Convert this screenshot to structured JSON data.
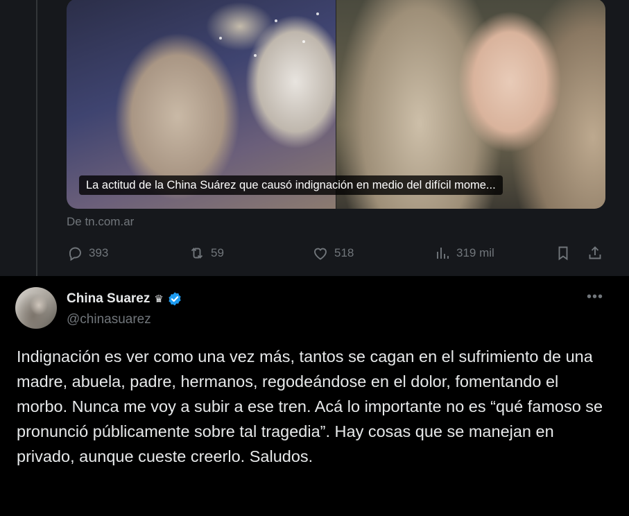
{
  "link_card": {
    "caption": "La actitud de la China Suárez que causó indignación en medio del difícil mome...",
    "source": "De tn.com.ar"
  },
  "parent_actions": {
    "replies": "393",
    "retweets": "59",
    "likes": "518",
    "views": "319 mil"
  },
  "tweet": {
    "display_name": "China Suarez",
    "crown_glyph": "♛",
    "handle": "@chinasuarez",
    "more_glyph": "•••",
    "text": "Indignación es ver como una vez más, tantos se cagan en el sufrimiento de una madre, abuela, padre, hermanos, regodeándose en el dolor, fomentando el morbo. Nunca me voy a subir a ese tren. Acá lo importante no es “qué famoso se pronunció públicamente sobre tal tragedia”. Hay cosas que se manejan en privado, aunque cueste creerlo. Saludos."
  },
  "colors": {
    "background": "#000000",
    "parent_background": "#16181c",
    "text": "#e7e9ea",
    "muted": "#71767b",
    "verified_blue": "#1d9bf0"
  },
  "icons": [
    "reply-icon",
    "retweet-icon",
    "like-icon",
    "views-icon",
    "bookmark-icon",
    "share-icon",
    "crown-icon",
    "verified-badge-icon",
    "more-options-icon"
  ]
}
